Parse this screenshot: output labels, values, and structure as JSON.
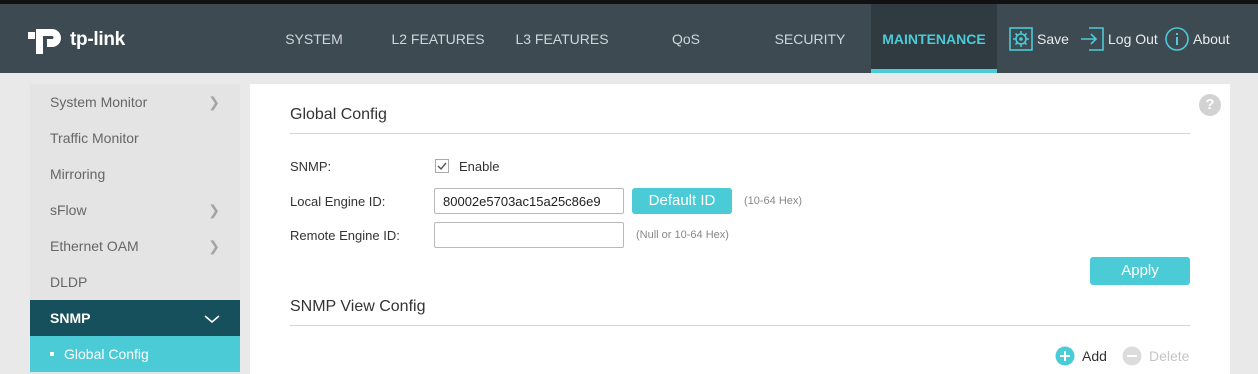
{
  "header": {
    "brand": "tp-link",
    "tabs": [
      {
        "label": "SYSTEM",
        "active": false
      },
      {
        "label": "L2 FEATURES",
        "active": false
      },
      {
        "label": "L3 FEATURES",
        "active": false
      },
      {
        "label": "QoS",
        "active": false
      },
      {
        "label": "SECURITY",
        "active": false
      },
      {
        "label": "MAINTENANCE",
        "active": true
      }
    ],
    "tools": {
      "save": "Save",
      "logout": "Log Out",
      "about": "About"
    }
  },
  "sidebar": {
    "items": [
      {
        "label": "System Monitor",
        "expandable": true
      },
      {
        "label": "Traffic Monitor",
        "expandable": false
      },
      {
        "label": "Mirroring",
        "expandable": false
      },
      {
        "label": "sFlow",
        "expandable": true
      },
      {
        "label": "Ethernet OAM",
        "expandable": true
      },
      {
        "label": "DLDP",
        "expandable": false
      },
      {
        "label": "SNMP",
        "expandable": true,
        "open": true
      }
    ],
    "subitems": [
      {
        "label": "Global Config",
        "active": true
      }
    ]
  },
  "global_config": {
    "title": "Global Config",
    "snmp_label": "SNMP:",
    "snmp_enable_label": "Enable",
    "snmp_enabled": true,
    "local_engine_label": "Local Engine ID:",
    "local_engine_value": "80002e5703ac15a25c86e9",
    "default_id_button": "Default ID",
    "local_engine_hint": "(10-64 Hex)",
    "remote_engine_label": "Remote Engine ID:",
    "remote_engine_value": "",
    "remote_engine_hint": "(Null or 10-64 Hex)",
    "apply_button": "Apply"
  },
  "snmp_view_config": {
    "title": "SNMP View Config",
    "add_label": "Add",
    "delete_label": "Delete"
  },
  "colors": {
    "accent": "#4acbd6",
    "topbar": "#3d4a52",
    "sidebar_open": "#17505d"
  },
  "help_icon": "?"
}
